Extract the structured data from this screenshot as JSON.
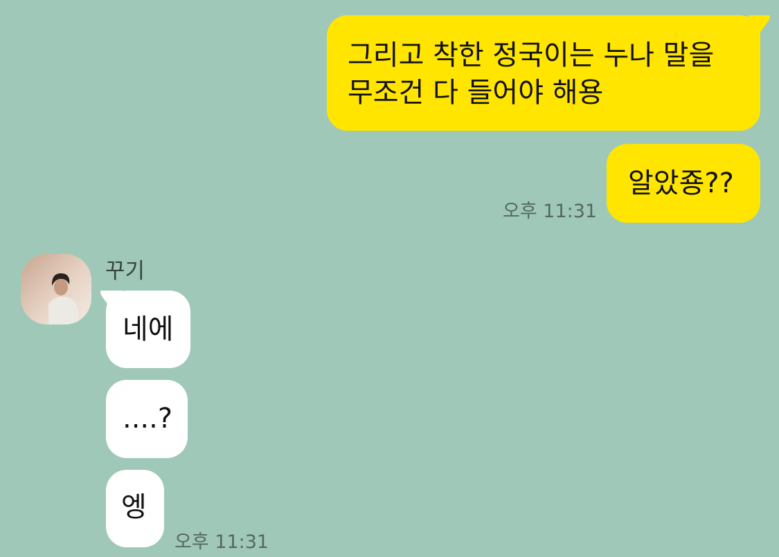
{
  "chat": {
    "outgoing": [
      {
        "lines": [
          "그리고 착한 정국이는 누나 말을",
          "무조건 다 들어야 해용"
        ]
      },
      {
        "text": "알았죵??",
        "time": "오후 11:31"
      }
    ],
    "incoming": {
      "sender_name": "꾸기",
      "avatar": "profile-photo",
      "messages": [
        "네에",
        "....?",
        "엥"
      ],
      "time": "오후 11:31"
    }
  },
  "colors": {
    "background": "#9fc8b8",
    "outgoing_bubble": "#ffe500",
    "incoming_bubble": "#ffffff",
    "timestamp": "#55685f",
    "sender_name": "#36463f"
  }
}
